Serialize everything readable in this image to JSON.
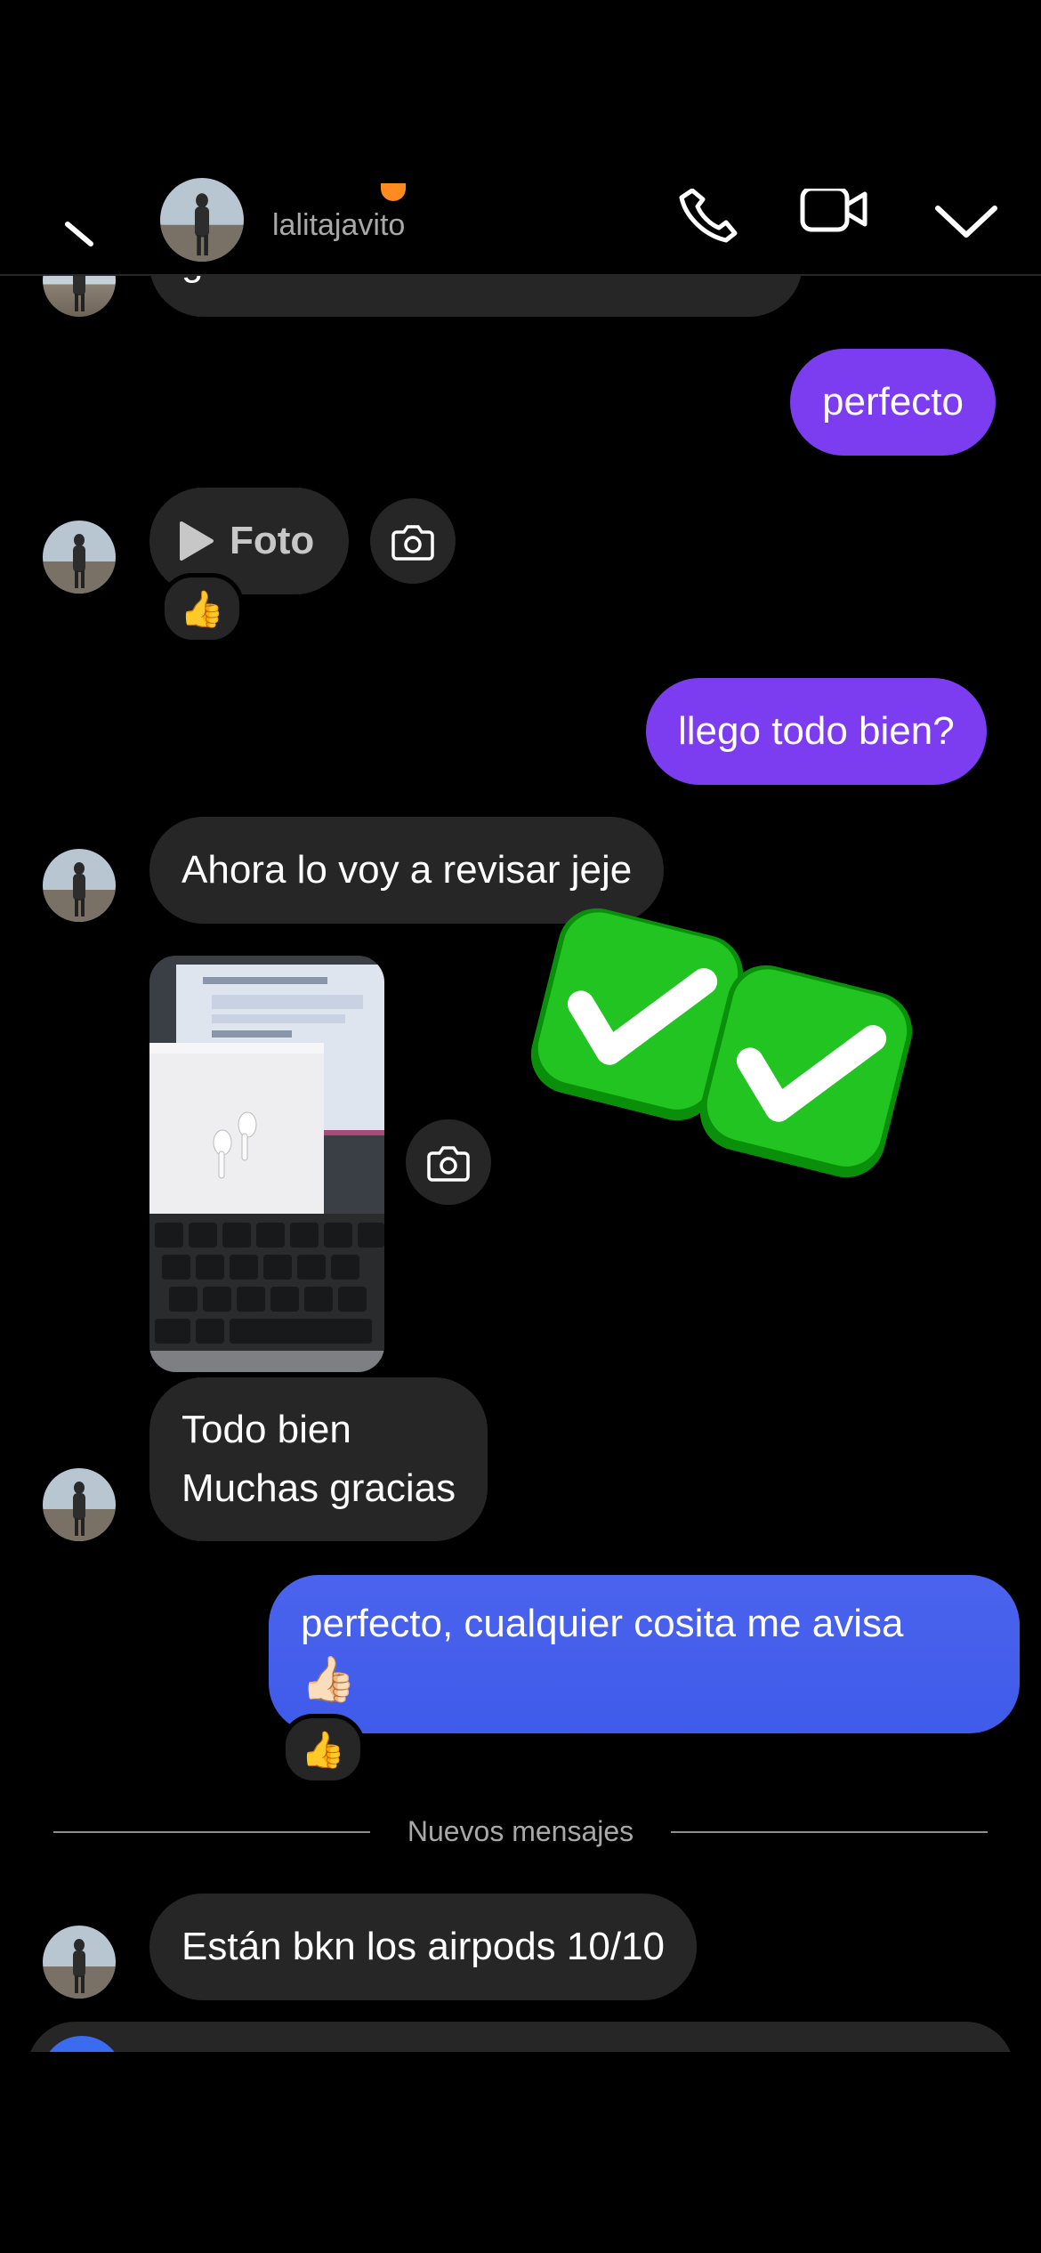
{
  "header": {
    "username": "lalitajavito"
  },
  "messages": {
    "partial_top": "gracias",
    "m1": "perfecto",
    "foto_label": "Foto",
    "reaction1": "👍",
    "m2": "llego todo bien?",
    "m3": "Ahora lo voy a revisar jeje",
    "m4_line1": "Todo bien",
    "m4_line2": "Muchas gracias",
    "m5_line1": "perfecto, cualquier cosita me avisa",
    "m5_emoji": "👍🏻",
    "reaction2": "👍",
    "new_messages_divider": "Nuevos mensajes",
    "m6": "Están bkn los airpods 10/10"
  },
  "icons": {
    "back": "chevron-left-icon",
    "call": "phone-icon",
    "video": "video-camera-icon",
    "info": "chevron-down-icon",
    "camera": "camera-icon",
    "play": "play-icon",
    "check_sticker": "check-mark-button-icon"
  },
  "colors": {
    "outgoing_purple": "#7c3cf0",
    "outgoing_blue": "#4b63ee",
    "incoming": "#262626",
    "background": "#000000"
  }
}
